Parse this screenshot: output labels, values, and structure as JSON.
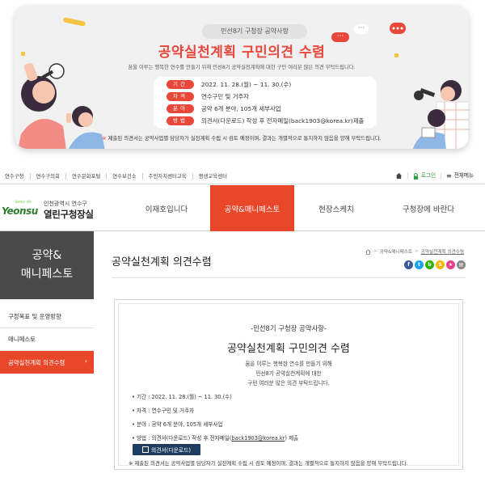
{
  "banner": {
    "pill": "민선8기 구청장 공약사항",
    "title": "공약실천계획 구민의견 수렴",
    "description": "꿈을 이루는 행복한 연수를 만들기 위해 민선8기 공약실천계획에 대한 구민 여러분 많은 의견 부탁드립니다.",
    "rows": [
      {
        "tag": "기간",
        "text": "2022. 11. 28.(월) ~ 11. 30.(수)"
      },
      {
        "tag": "자격",
        "text": "연수구민 및 거주자"
      },
      {
        "tag": "분야",
        "text": "공약 6개 분야, 105개 세부사업"
      },
      {
        "tag": "방법",
        "text": "의견서(다운로드) 작성 후 전자메일(back1903@korea.kr)제출"
      }
    ],
    "note_star": "※",
    "note": "제출된 의견서는 공약사업별 담당자가 실천계획 수립 시 검토 예정이며, 결과는 개별적으로 통지하지 않음을 양해 부탁드립니다.",
    "colors": {
      "accent": "#e8473a",
      "card": "#f1f1f1"
    }
  },
  "util": {
    "links": [
      "연수구청",
      "연수구의회",
      "연수문화포털",
      "연수보건소",
      "주민자치센터교육",
      "평생교육센터"
    ],
    "home_icon": "home-icon",
    "login": "로그인",
    "menu": "전체메뉴"
  },
  "header": {
    "logo_sub": "인천광역시 연수구",
    "logo_main": "열린구청장실",
    "logo_mark": "Yeonsu",
    "logo_mark_small": "Better life",
    "nav": [
      "이재호입니다",
      "공약&매니페스토",
      "현장스케치",
      "구청장에 바란다"
    ],
    "active_index": 1
  },
  "sidebar": {
    "title_line1": "공약&",
    "title_line2": "매니페스토",
    "items": [
      "구정목표 및 운영방향",
      "매니페스토",
      "공약실천계획 의견수렴"
    ],
    "active_arrow": "›"
  },
  "main": {
    "title": "공약실천계획 의견수렴",
    "breadcrumb": [
      "공약&매니페스토",
      "공약실천계획 의견수렴"
    ],
    "share": [
      {
        "label": "f",
        "color": "#3b5998",
        "icon": "facebook-icon"
      },
      {
        "label": "t",
        "color": "#1da1f2",
        "icon": "twitter-icon"
      },
      {
        "label": "b",
        "color": "#2db400",
        "icon": "blog-icon"
      },
      {
        "label": "S",
        "color": "#f7b500",
        "icon": "kakaostory-icon"
      },
      {
        "label": "★",
        "color": "#e83e8c",
        "icon": "bookmark-icon"
      },
      {
        "label": "▤",
        "color": "#888888",
        "icon": "print-icon"
      }
    ]
  },
  "content": {
    "subtitle": "-민선8기 구청장 공약사항-",
    "title": "공약실천계획 구민의견 수렴",
    "desc_line1": "꿈을 이루는 행복한 연수를 만들기 위해",
    "desc_line2": "민선8기 공약실천계획에 대한",
    "desc_line3": "구민 여러분 많은 의견 부탁드립니다.",
    "items": [
      "• 기간 : 2022. 11. 28.(월) ~ 11. 30.(수)",
      "• 자격 : 연수구민 및 거주자",
      "• 분야 : 공약 6개 분야, 105개 세부사업"
    ],
    "method_prefix": "• 방법 : 의견서(다운로드) 작성 후 전자메일(",
    "method_link": "back1903@korea.kr",
    "method_suffix": ") 제출",
    "download_label": "의견서(다운로드)",
    "note": "※ 제출된 의견서는 공약사업별 담당자가 실천계획 수립 시 검토 예정이며, 결과는 개별적으로 통지하지 않음을 양해 부탁드립니다."
  }
}
